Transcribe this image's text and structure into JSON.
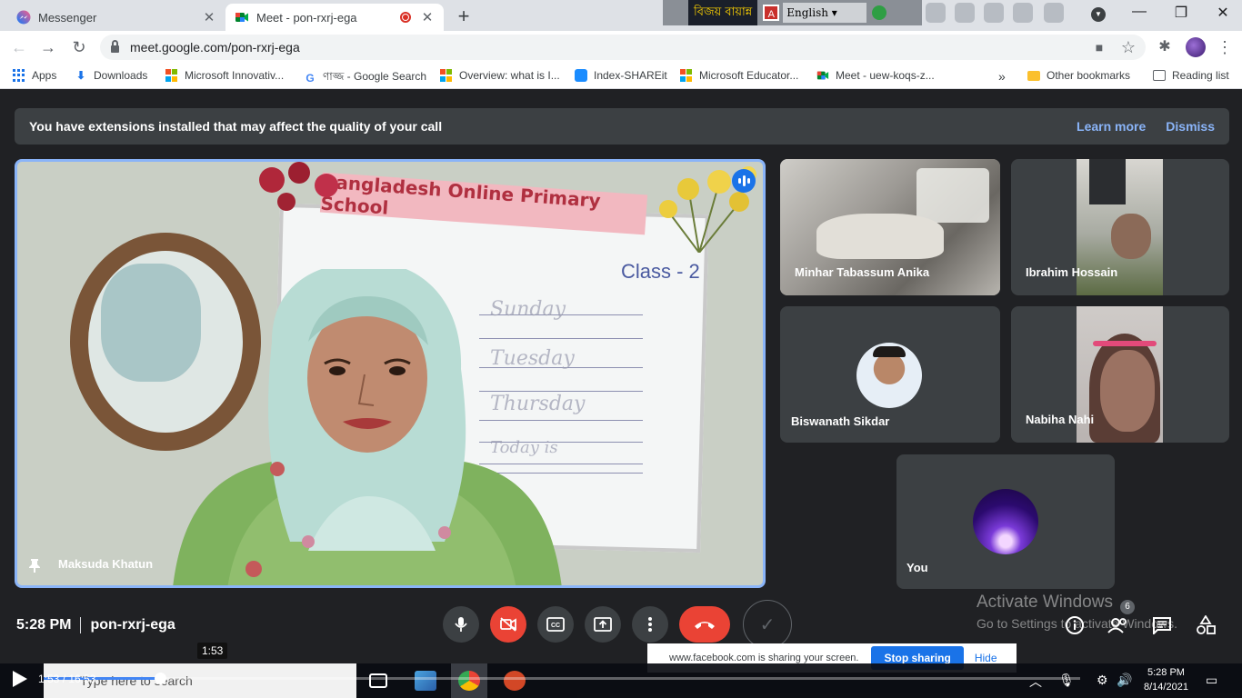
{
  "browser": {
    "tabs": [
      {
        "title": "Messenger",
        "icon": "messenger-icon"
      },
      {
        "title": "Meet - pon-rxrj-ega",
        "icon": "meet-icon",
        "recording": true
      }
    ],
    "url": "meet.google.com/pon-rxrj-ega",
    "bookmarks": [
      {
        "label": "Apps",
        "icon": "apps-grid-icon"
      },
      {
        "label": "Downloads",
        "icon": "download-icon"
      },
      {
        "label": "Microsoft Innovativ...",
        "icon": "microsoft-icon"
      },
      {
        "label": "ণাজ্জ - Google Search",
        "icon": "google-icon"
      },
      {
        "label": "Overview: what is I...",
        "icon": "microsoft-icon"
      },
      {
        "label": "Index-SHAREit",
        "icon": "shareit-icon"
      },
      {
        "label": "Microsoft Educator...",
        "icon": "microsoft-icon"
      },
      {
        "label": "Meet - uew-koqs-z...",
        "icon": "meet-icon"
      }
    ],
    "more_bookmarks": "»",
    "other_bookmarks": "Other bookmarks",
    "reading_list": "Reading list"
  },
  "overlay_toolbar": {
    "bangla_label": "বিজয় বায়ান্ন",
    "language": "English",
    "language_shadow": "English"
  },
  "banner": {
    "message": "You have extensions installed that may affect the quality of your call",
    "learn_more": "Learn more",
    "dismiss": "Dismiss"
  },
  "main_tile": {
    "name": "Maksuda Khatun",
    "board_title": "Bangladesh Online Primary School",
    "board_class": "Class - 2",
    "board_words": [
      "Sunday",
      "Tuesday",
      "Thursday",
      "Today is"
    ]
  },
  "participants": [
    {
      "name": "Minhar Tabassum Anika"
    },
    {
      "name": "Ibrahim Hossain"
    },
    {
      "name": "Biswanath Sikdar"
    },
    {
      "name": "Nabiha Nahi"
    },
    {
      "name": "You"
    }
  ],
  "footer": {
    "time": "5:28 PM",
    "meeting_code": "pon-rxrj-ega",
    "participant_count": "6"
  },
  "watermark": {
    "line1": "Activate Windows",
    "line2": "Go to Settings to activate Windows."
  },
  "share_bar": {
    "text": "www.facebook.com is sharing your screen.",
    "stop": "Stop sharing",
    "hide": "Hide"
  },
  "player": {
    "tooltip": "1:53",
    "position": "1:53 / 16:53",
    "progress": 0.112
  },
  "taskbar": {
    "search_placeholder": "Type here to search",
    "clock_time": "5:28 PM",
    "clock_date": "8/14/2021"
  },
  "colors": {
    "meet_bg": "#202124",
    "accent": "#8ab4f8",
    "danger": "#ea4335"
  }
}
